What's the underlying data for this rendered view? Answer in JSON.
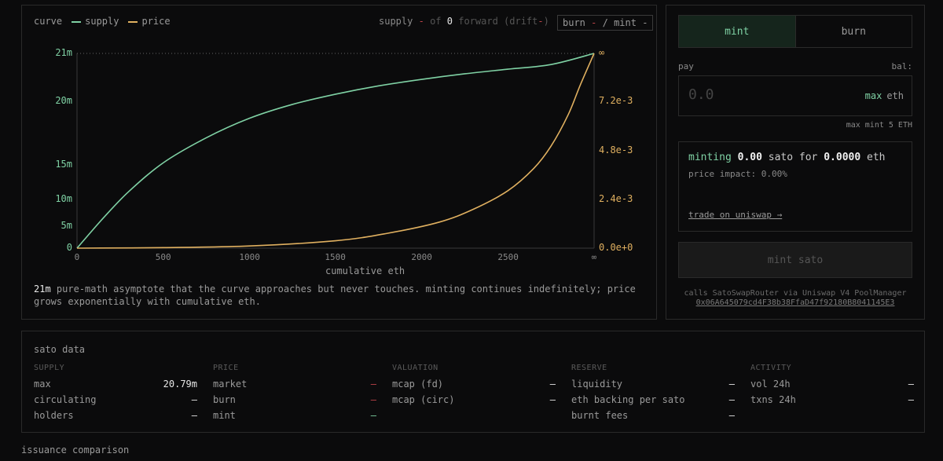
{
  "chart_panel": {
    "legend": {
      "curve": "curve",
      "supply": "supply",
      "price": "price"
    },
    "stat": {
      "supply": "supply",
      "sep": "-",
      "of": "of",
      "count": "0",
      "forward": "forward",
      "drift_open": "(drift",
      "drift_val": "-",
      "drift_close": ")"
    },
    "burnmint": {
      "burn": "burn",
      "burn_val": "-",
      "slash": "/",
      "mint": "mint",
      "mint_val": "-"
    },
    "footnote": {
      "highlight": "21m",
      "text": "pure-math asymptote that the curve approaches but never touches. minting continues indefinitely; price grows exponentially with cumulative eth."
    }
  },
  "chart_data": {
    "type": "line",
    "title": "",
    "xlabel": "cumulative eth",
    "ylabel": "",
    "x_ticks": [
      "0",
      "500",
      "1000",
      "1500",
      "2000",
      "2500",
      "∞"
    ],
    "y_left_ticks": [
      "21m",
      "20m",
      "15m",
      "10m",
      "5m",
      "0"
    ],
    "y_right_ticks": [
      "∞",
      "7.2e-3",
      "4.8e-3",
      "2.4e-3",
      "0.0e+0"
    ],
    "series": [
      {
        "name": "supply",
        "color": "#7fd1a4",
        "x": [
          0,
          150,
          300,
          500,
          750,
          1000,
          1250,
          1500,
          1750,
          2000,
          2250,
          2500,
          2750,
          3000
        ],
        "y": [
          0,
          3.2,
          6.1,
          9.2,
          11.9,
          14.0,
          15.5,
          16.6,
          17.5,
          18.2,
          18.8,
          19.3,
          19.8,
          21
        ]
      },
      {
        "name": "price",
        "color": "#e0b060",
        "x": [
          0,
          500,
          1000,
          1500,
          1800,
          2100,
          2300,
          2500,
          2650,
          2750,
          2850,
          2920,
          3000
        ],
        "y": [
          0,
          3e-05,
          0.00012,
          0.0004,
          0.0008,
          0.0014,
          0.0021,
          0.0031,
          0.0043,
          0.0055,
          0.0072,
          0.0088,
          0.0105
        ]
      }
    ],
    "ylim_left": [
      0,
      21
    ],
    "ylim_right": [
      0,
      0.0105
    ],
    "xlim": [
      0,
      3000
    ],
    "grid": false
  },
  "trade": {
    "tab_mint": "mint",
    "tab_burn": "burn",
    "pay_label": "pay",
    "bal_label": "bal:",
    "amount_placeholder": "0.0",
    "max_label": "max",
    "unit": "eth",
    "max_mint": "max mint 5 ETH",
    "minting_word": "minting",
    "sato_amount": "0.00",
    "sato_word": "sato for",
    "eth_amount": "0.0000",
    "eth_word": "eth",
    "price_impact": "price impact: 0.00%",
    "uniswap": "trade on uniswap →",
    "button": "mint sato",
    "calls": "calls SatoSwapRouter via Uniswap V4 PoolManager",
    "address": "0x06A645079cd4F38b38FfaD47f92180B8041145E3"
  },
  "data": {
    "title": "sato data",
    "columns": [
      {
        "head": "SUPPLY",
        "rows": [
          {
            "k": "max",
            "v": "20.79m"
          },
          {
            "k": "circulating",
            "v": "–"
          },
          {
            "k": "holders",
            "v": "–"
          }
        ]
      },
      {
        "head": "PRICE",
        "rows": [
          {
            "k": "market",
            "v": "–"
          },
          {
            "k": "burn",
            "v": "–"
          },
          {
            "k": "mint",
            "v": "–"
          }
        ]
      },
      {
        "head": "VALUATION",
        "rows": [
          {
            "k": "mcap (fd)",
            "v": "–"
          },
          {
            "k": "mcap (circ)",
            "v": "–"
          }
        ]
      },
      {
        "head": "RESERVE",
        "rows": [
          {
            "k": "liquidity",
            "v": "–"
          },
          {
            "k": "eth backing per sato",
            "v": "–"
          },
          {
            "k": "burnt fees",
            "v": "–"
          }
        ]
      },
      {
        "head": "ACTIVITY",
        "rows": [
          {
            "k": "vol 24h",
            "v": "–"
          },
          {
            "k": "txns 24h",
            "v": "–"
          }
        ]
      }
    ]
  },
  "issuance": "issuance comparison"
}
